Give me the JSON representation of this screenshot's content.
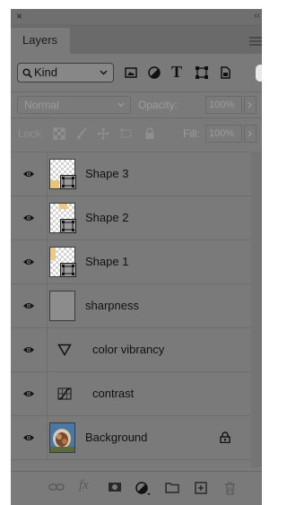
{
  "panel": {
    "close_glyph": "×",
    "collapse_glyph": "‹‹",
    "tab_label": "Layers",
    "menu_icon": "panel-menu-icon"
  },
  "filter": {
    "kind_label": "Kind",
    "icons": [
      "pixel-layer-filter-icon",
      "adjustment-layer-filter-icon",
      "type-layer-filter-icon",
      "shape-layer-filter-icon",
      "smart-object-filter-icon"
    ],
    "type_glyph": "T"
  },
  "blend": {
    "mode": "Normal",
    "opacity_label": "Opacity:",
    "opacity_value": "100%"
  },
  "lock": {
    "label": "Lock:",
    "fill_label": "Fill:",
    "fill_value": "100%"
  },
  "layers": [
    {
      "name": "Shape 3",
      "type": "shape",
      "visible": true
    },
    {
      "name": "Shape 2",
      "type": "shape",
      "visible": true
    },
    {
      "name": "Shape 1",
      "type": "shape",
      "visible": true
    },
    {
      "name": "sharpness",
      "type": "pixel",
      "visible": true
    },
    {
      "name": "color vibrancy",
      "type": "adjustment",
      "adjustment_icon": "triangle-down-icon",
      "visible": true
    },
    {
      "name": "contrast",
      "type": "adjustment",
      "adjustment_icon": "curves-icon",
      "visible": true
    },
    {
      "name": "Background",
      "type": "image",
      "locked": true,
      "visible": true
    }
  ],
  "bottom_bar": {
    "fx_label": "fx",
    "icons": [
      "link-icon",
      "fx-icon",
      "mask-icon",
      "adjustment-icon",
      "folder-icon",
      "new-layer-icon",
      "trash-icon"
    ]
  },
  "colors": {
    "panel_bg": "#7a7a7a",
    "text": "#111111",
    "disabled_text": "#9c9c9c"
  }
}
